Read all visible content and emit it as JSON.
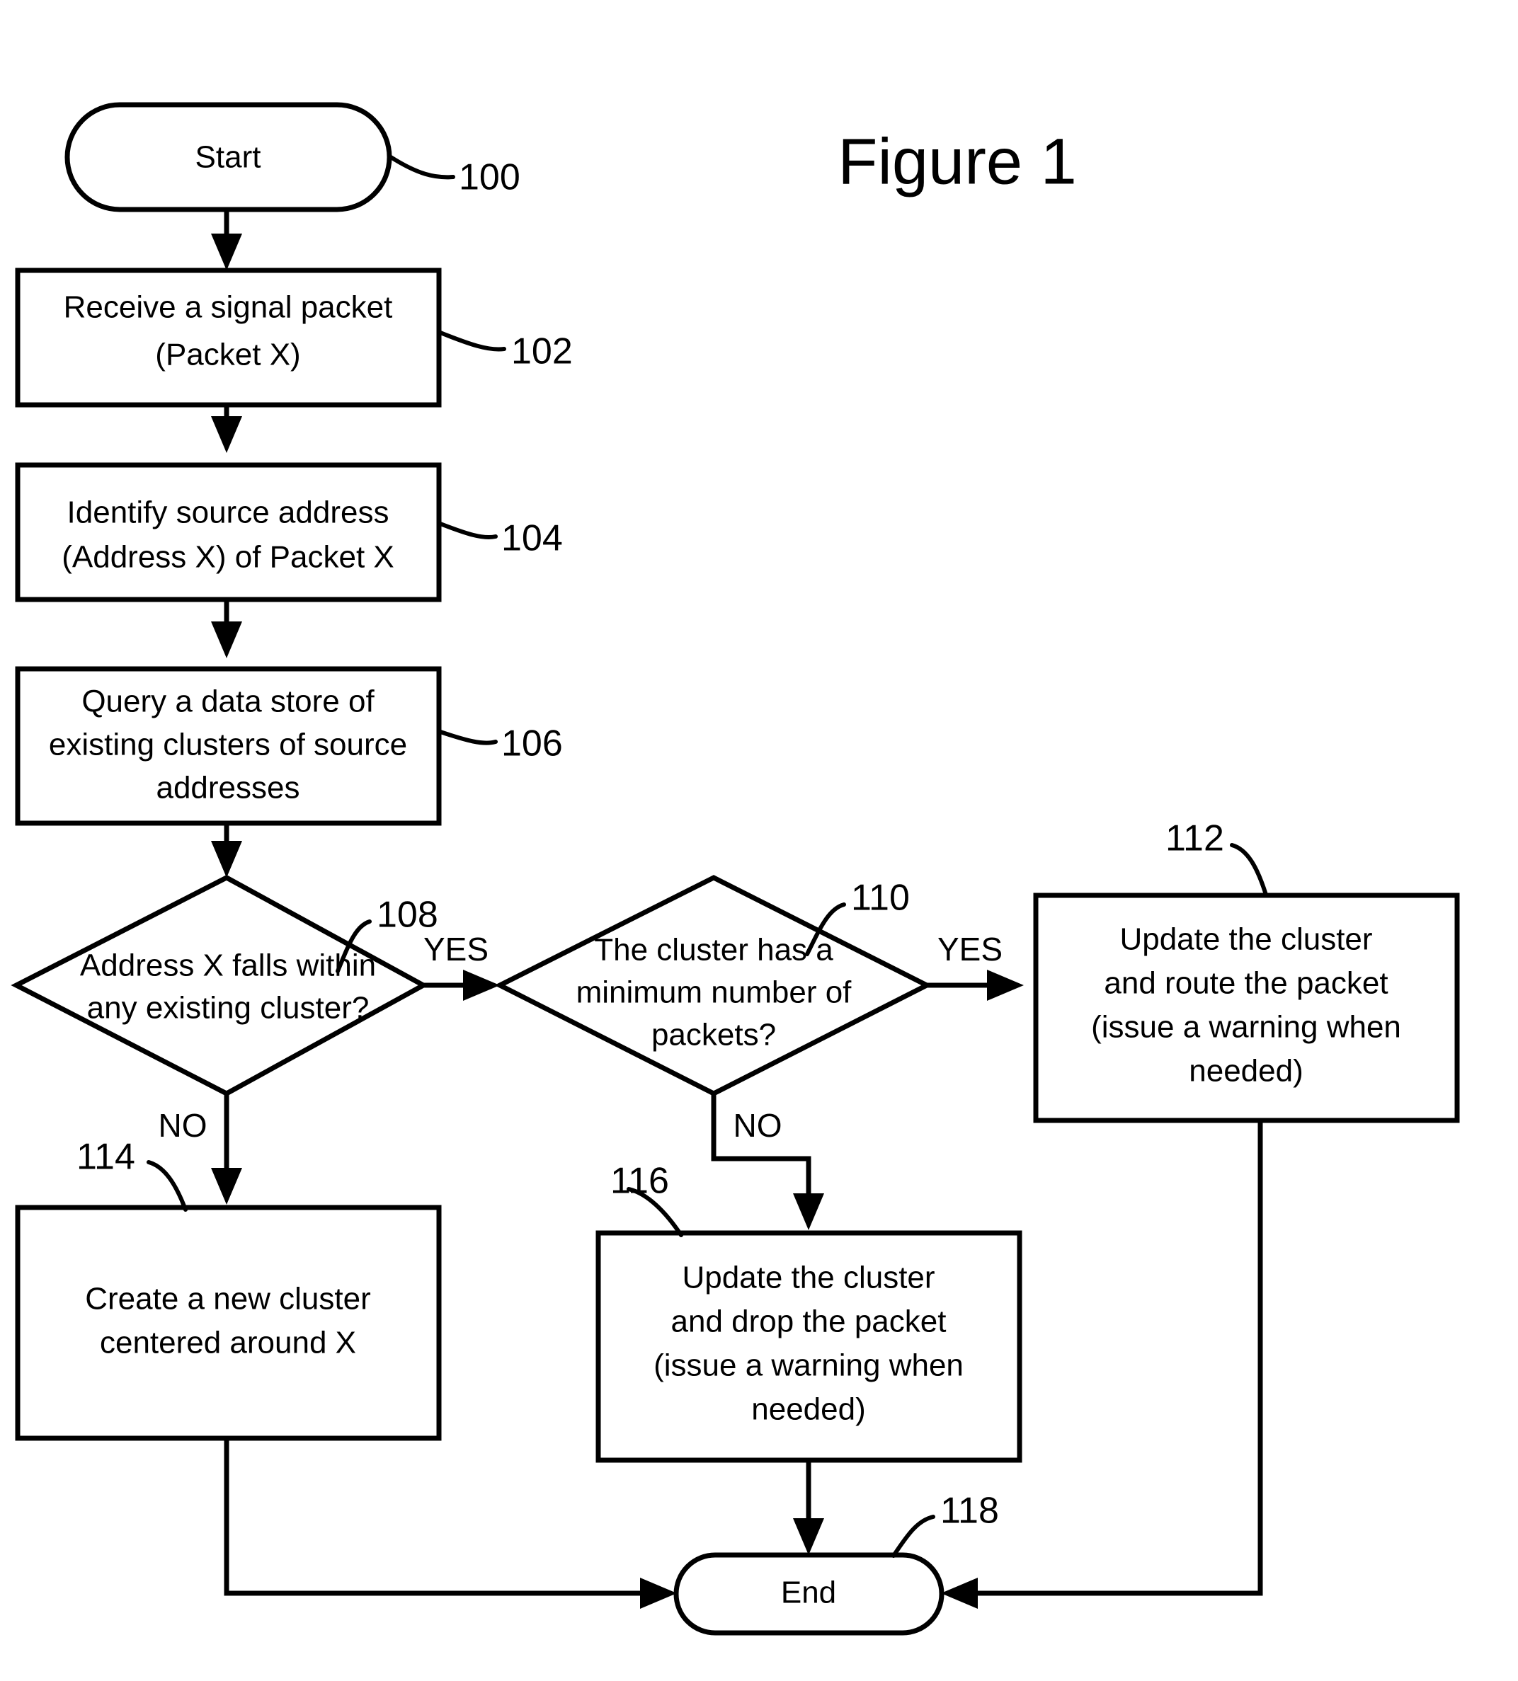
{
  "figure": {
    "title": "Figure 1",
    "type": "patent-flowchart"
  },
  "nodes": {
    "start": {
      "ref": "100",
      "shape": "terminator",
      "lines": [
        "Start"
      ]
    },
    "receive_packet": {
      "ref": "102",
      "shape": "process",
      "lines": [
        "Receive a signal packet",
        "(Packet X)"
      ]
    },
    "identify_address": {
      "ref": "104",
      "shape": "process",
      "lines": [
        "Identify source address",
        "(Address X) of Packet X"
      ]
    },
    "query_store": {
      "ref": "106",
      "shape": "process",
      "lines": [
        "Query a data store of",
        "existing clusters of source",
        "addresses"
      ]
    },
    "decision_cluster": {
      "ref": "108",
      "shape": "decision",
      "lines": [
        "Address X falls within",
        "any existing cluster?"
      ]
    },
    "decision_min_packets": {
      "ref": "110",
      "shape": "decision",
      "lines": [
        "The cluster has a",
        "minimum number of",
        "packets?"
      ]
    },
    "update_route": {
      "ref": "112",
      "shape": "process",
      "lines": [
        "Update the cluster",
        "and route the packet",
        "(issue a warning when",
        "needed)"
      ]
    },
    "create_cluster": {
      "ref": "114",
      "shape": "process",
      "lines": [
        "Create a new cluster",
        "centered around X"
      ]
    },
    "update_drop": {
      "ref": "116",
      "shape": "process",
      "lines": [
        "Update the cluster",
        "and drop the packet",
        "(issue a warning when",
        "needed)"
      ]
    },
    "end": {
      "ref": "118",
      "shape": "terminator",
      "lines": [
        "End"
      ]
    }
  },
  "branch_labels": {
    "yes_108": "YES",
    "no_108": "NO",
    "yes_110": "YES",
    "no_110": "NO"
  },
  "colors": {
    "stroke": "#000000",
    "fill": "#ffffff",
    "text": "#000000"
  }
}
